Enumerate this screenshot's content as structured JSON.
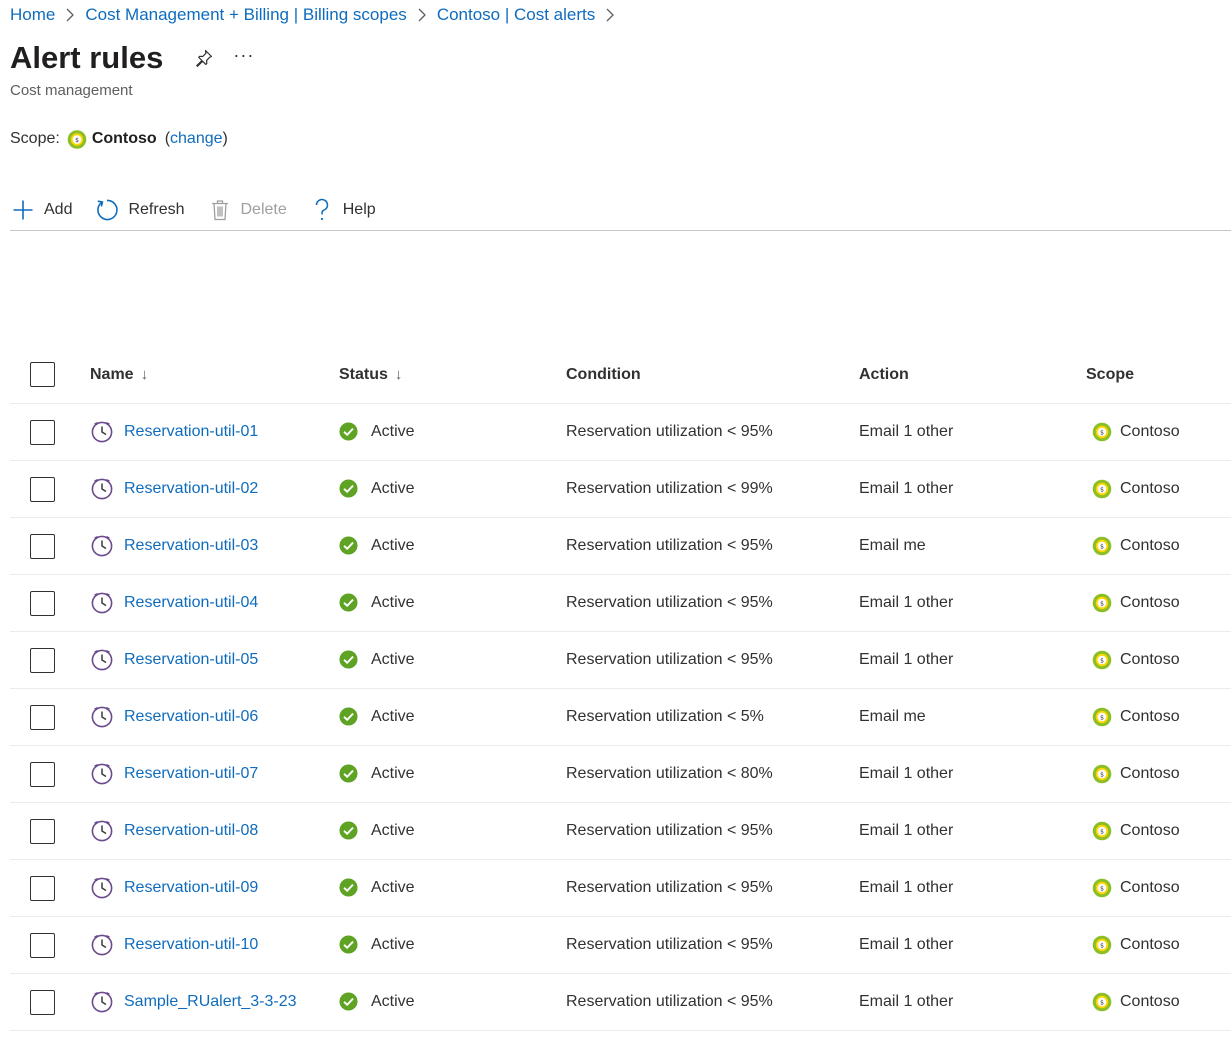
{
  "breadcrumb": [
    "Home",
    "Cost Management + Billing | Billing scopes",
    "Contoso | Cost alerts"
  ],
  "page": {
    "title": "Alert rules",
    "subtitle": "Cost management",
    "more_label": "···"
  },
  "scope": {
    "label": "Scope:",
    "name": "Contoso",
    "change_open": "(",
    "change_link": "change",
    "change_close": ")"
  },
  "toolbar": {
    "add": "Add",
    "refresh": "Refresh",
    "delete": "Delete",
    "help": "Help"
  },
  "columns": {
    "name": "Name",
    "status": "Status",
    "condition": "Condition",
    "action": "Action",
    "scope": "Scope",
    "sort_arrow": "↓"
  },
  "rows": [
    {
      "name": "Reservation-util-01",
      "status": "Active",
      "condition": "Reservation utilization < 95%",
      "action": "Email 1 other",
      "scope": "Contoso"
    },
    {
      "name": "Reservation-util-02",
      "status": "Active",
      "condition": "Reservation utilization < 99%",
      "action": "Email 1 other",
      "scope": "Contoso"
    },
    {
      "name": "Reservation-util-03",
      "status": "Active",
      "condition": "Reservation utilization < 95%",
      "action": "Email me",
      "scope": "Contoso"
    },
    {
      "name": "Reservation-util-04",
      "status": "Active",
      "condition": "Reservation utilization < 95%",
      "action": "Email 1 other",
      "scope": "Contoso"
    },
    {
      "name": "Reservation-util-05",
      "status": "Active",
      "condition": "Reservation utilization < 95%",
      "action": "Email 1 other",
      "scope": "Contoso"
    },
    {
      "name": "Reservation-util-06",
      "status": "Active",
      "condition": "Reservation utilization < 5%",
      "action": "Email me",
      "scope": "Contoso"
    },
    {
      "name": "Reservation-util-07",
      "status": "Active",
      "condition": "Reservation utilization < 80%",
      "action": "Email 1 other",
      "scope": "Contoso"
    },
    {
      "name": "Reservation-util-08",
      "status": "Active",
      "condition": "Reservation utilization < 95%",
      "action": "Email 1 other",
      "scope": "Contoso"
    },
    {
      "name": "Reservation-util-09",
      "status": "Active",
      "condition": "Reservation utilization < 95%",
      "action": "Email 1 other",
      "scope": "Contoso"
    },
    {
      "name": "Reservation-util-10",
      "status": "Active",
      "condition": "Reservation utilization < 95%",
      "action": "Email 1 other",
      "scope": "Contoso"
    },
    {
      "name": "Sample_RUalert_3-3-23",
      "status": "Active",
      "condition": "Reservation utilization < 95%",
      "action": "Email 1 other",
      "scope": "Contoso"
    }
  ],
  "colors": {
    "link": "#0f6cbd",
    "active_green": "#5ea323",
    "clock_purple": "#6b4a8e",
    "scope_green": "#8cbf26",
    "scope_yellow": "#ffd400"
  },
  "icons": {
    "pin": "pin-icon",
    "add": "plus-icon",
    "refresh": "refresh-icon",
    "delete": "trash-icon",
    "help": "question-icon",
    "alert": "clock-icon",
    "status": "check-circle-icon",
    "scope": "billing-scope-icon"
  }
}
